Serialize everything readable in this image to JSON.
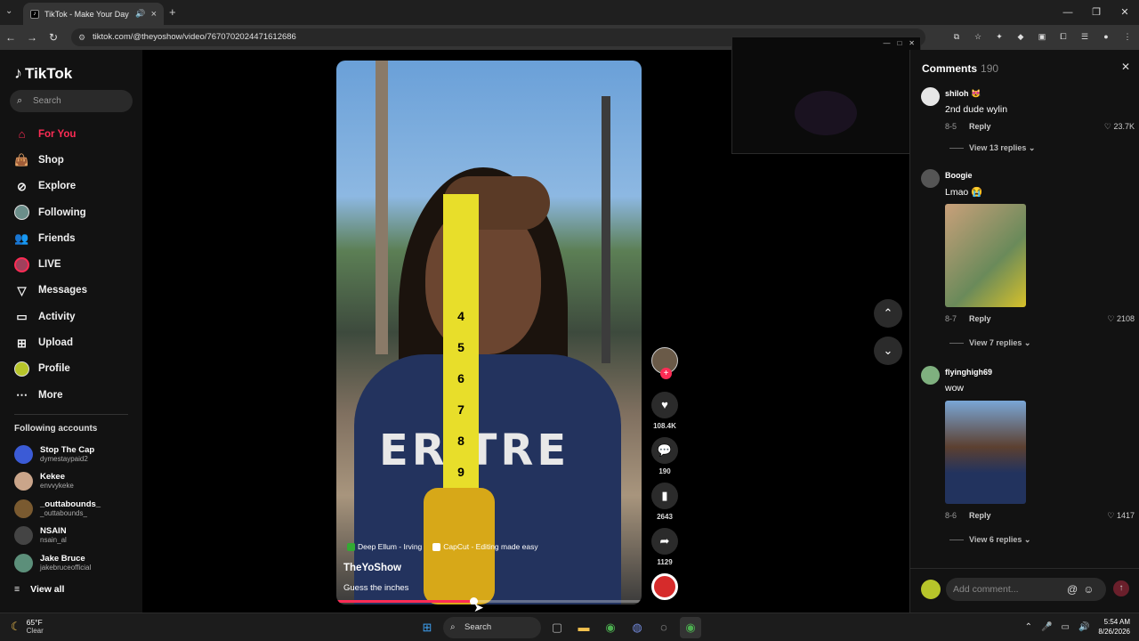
{
  "browser": {
    "tab_title": "TikTok - Make Your Day",
    "url": "tiktok.com/@theyoshow/video/7670702024471612686"
  },
  "sidebar": {
    "logo": "TikTok",
    "search_placeholder": "Search",
    "nav": [
      {
        "label": "For You",
        "icon": "home-icon",
        "active": true
      },
      {
        "label": "Shop",
        "icon": "shop-bag-icon"
      },
      {
        "label": "Explore",
        "icon": "compass-icon"
      },
      {
        "label": "Following",
        "icon": "following-avatar-icon"
      },
      {
        "label": "Friends",
        "icon": "friends-icon"
      },
      {
        "label": "LIVE",
        "icon": "live-avatar-icon"
      },
      {
        "label": "Messages",
        "icon": "messages-icon"
      },
      {
        "label": "Activity",
        "icon": "activity-icon"
      },
      {
        "label": "Upload",
        "icon": "upload-icon"
      },
      {
        "label": "Profile",
        "icon": "profile-avatar-icon"
      },
      {
        "label": "More",
        "icon": "more-dots-icon"
      }
    ],
    "following_header": "Following accounts",
    "following": [
      {
        "name": "Stop The Cap",
        "handle": "dymestaypaid2",
        "color": "#3b5bd6"
      },
      {
        "name": "Kekee",
        "handle": "envvykeke",
        "color": "#caa58a"
      },
      {
        "name": "_outtabounds_",
        "handle": "_outtabounds_",
        "color": "#7a5a30"
      },
      {
        "name": "NSAIN",
        "handle": "nsain_al",
        "color": "#444444"
      },
      {
        "name": "Jake Bruce",
        "handle": "jakebruceofficial",
        "color": "#5c8f7a"
      }
    ],
    "view_all": "View all"
  },
  "video": {
    "tag_effect": "Deep Ellum - Irving",
    "tag_capcut": "CapCut - Editing made easy",
    "author": "TheYoShow",
    "description": "Guess the inches",
    "shirt_text": "ERITRE",
    "tape_numbers": [
      "4",
      "5",
      "6",
      "7",
      "8",
      "9"
    ],
    "progress": 0.45
  },
  "actions": {
    "likes": "108.4K",
    "comments": "190",
    "saves": "2643",
    "shares": "1129"
  },
  "comments_panel": {
    "title": "Comments",
    "count": "190",
    "add_placeholder": "Add comment...",
    "items": [
      {
        "name": "shiloh 😻",
        "text": "2nd dude wylin",
        "date": "8-5",
        "reply": "Reply",
        "likes": "23.7K",
        "replies": "View 13 replies",
        "avatar": "#e6e6e6"
      },
      {
        "name": "Boogie",
        "text": "Lmao 😭",
        "date": "8-7",
        "reply": "Reply",
        "likes": "2108",
        "replies": "View 7 replies",
        "avatar": "#555555"
      },
      {
        "name": "flyinghigh69",
        "text": "wow",
        "date": "8-6",
        "reply": "Reply",
        "likes": "1417",
        "replies": "View 6 replies",
        "avatar": "#7fb07f"
      }
    ]
  },
  "taskbar": {
    "temp": "65°F",
    "condition": "Clear",
    "search": "Search",
    "time": "5:54 AM",
    "date": "8/26/2026"
  }
}
